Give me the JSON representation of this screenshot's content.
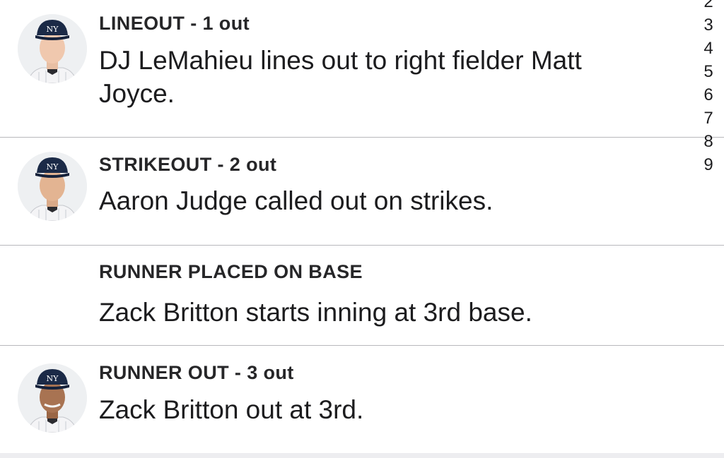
{
  "plays": [
    {
      "headline": "LINEOUT - 1 out",
      "description": "DJ LeMahieu lines out to right fielder Matt Joyce.",
      "avatar_icon": "player-headshot-icon"
    },
    {
      "headline": "STRIKEOUT - 2 out",
      "description": "Aaron Judge called out on strikes.",
      "avatar_icon": "player-headshot-icon"
    },
    {
      "headline": "RUNNER PLACED ON BASE",
      "description": "Zack Britton starts inning at 3rd base."
    },
    {
      "headline": "RUNNER OUT - 3 out",
      "description": "Zack Britton out at 3rd.",
      "avatar_icon": "player-headshot-icon"
    }
  ],
  "inning_index": [
    "2",
    "3",
    "4",
    "5",
    "6",
    "7",
    "8",
    "9"
  ],
  "colors": {
    "cap_navy": "#1b2a47",
    "divider": "#b8b8bc",
    "text": "#1c1c1e"
  }
}
